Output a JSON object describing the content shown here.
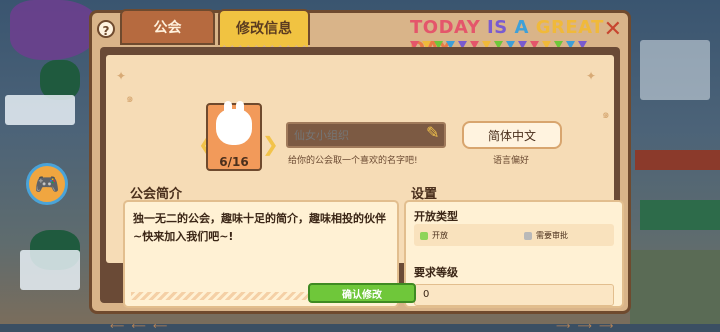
{
  "tabs": [
    {
      "label": "公会",
      "active": false
    },
    {
      "label": "修改信息",
      "active": true
    }
  ],
  "banner": {
    "words": [
      "TODAY",
      "IS",
      "A",
      "GREAT",
      "DAY"
    ]
  },
  "avatar": {
    "count": "6/16"
  },
  "name_input": {
    "placeholder": "仙女小组织",
    "hint": "给你的公会取一个喜欢的名字吧!"
  },
  "language": {
    "value": "简体中文",
    "label": "语言偏好"
  },
  "intro": {
    "title": "公会简介",
    "text": "独一无二的公会，趣味十足的简介，趣味相投的伙伴~快来加入我们吧~!"
  },
  "settings": {
    "title": "设置",
    "open_type_label": "开放类型",
    "options": [
      {
        "label": "开放",
        "selected": true
      },
      {
        "label": "需要审批",
        "selected": false
      }
    ],
    "level_label": "要求等级",
    "level_value": "0"
  },
  "confirm_button": "确认修改",
  "colors": {
    "accent_tab": "#f1c341",
    "confirm": "#6fc73a",
    "panel": "#d9b489",
    "close": "#c7452f"
  }
}
